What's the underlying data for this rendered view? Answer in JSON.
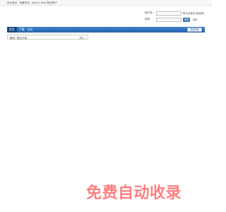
{
  "topbar": {
    "links": [
      "设为首页",
      "收藏本站",
      "Switch Mod 数论精子"
    ]
  },
  "login": {
    "username_label": "用户名：",
    "password_label": "密码",
    "auto_login": "自动登录",
    "forgot_password": "找回密码",
    "login_button": "登录",
    "register": "注册"
  },
  "nav": {
    "tabs": [
      "首页",
      "下载",
      "论坛"
    ],
    "publish_button": "快速导航"
  },
  "breadcrumb": {
    "path": "题组 › 数论方程",
    "more": "更多 ›"
  },
  "watermark": {
    "text": "免费自动收录"
  },
  "colors": {
    "nav_bg": "#2462ad",
    "nav_active": "#17467f",
    "watermark": "#ff7f7f"
  }
}
